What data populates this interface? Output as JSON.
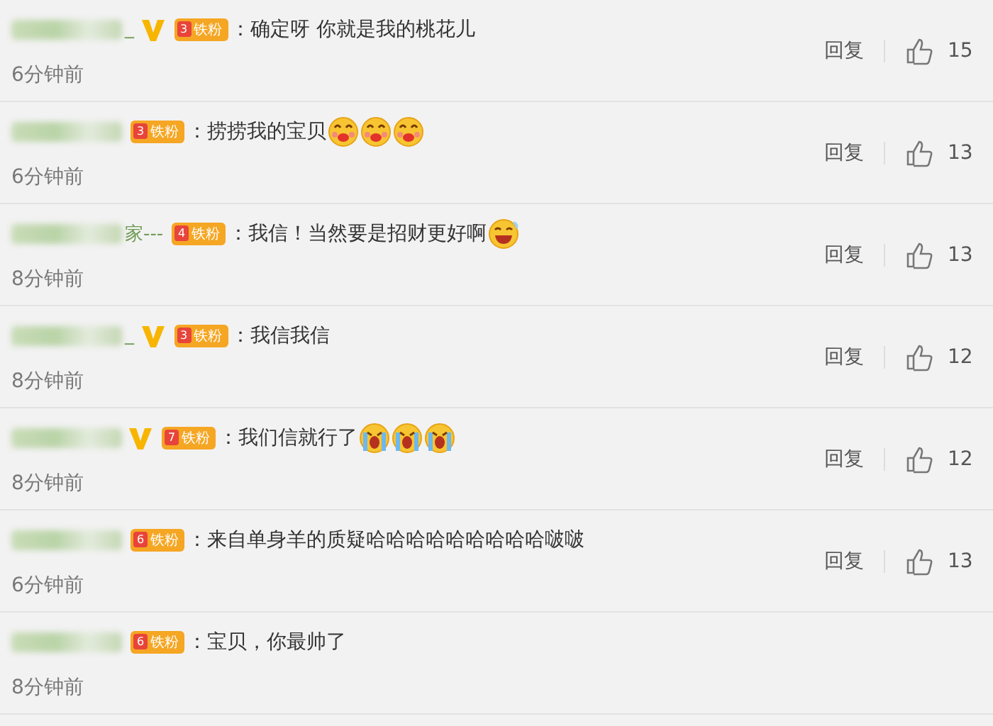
{
  "comments": [
    {
      "name_suffix": "_",
      "verified": true,
      "badge": {
        "level": "3",
        "label": "铁粉"
      },
      "text": "：确定呀 你就是我的桃花儿",
      "time": "6分钟前",
      "reply": "回复",
      "likes": "15"
    },
    {
      "verified": false,
      "badge": {
        "level": "3",
        "label": "铁粉"
      },
      "text": "：捞捞我的宝贝",
      "emojis": [
        {
          "kind": "kiss"
        },
        {
          "kind": "kiss"
        },
        {
          "kind": "kiss"
        }
      ],
      "time": "6分钟前",
      "reply": "回复",
      "likes": "13"
    },
    {
      "name_suffix": "家---",
      "verified": false,
      "badge": {
        "level": "4",
        "label": "铁粉"
      },
      "text": "：我信！当然要是招财更好啊",
      "emojis": [
        {
          "kind": "laugh"
        }
      ],
      "time": "8分钟前",
      "reply": "回复",
      "likes": "13"
    },
    {
      "name_suffix": "_",
      "verified": true,
      "badge": {
        "level": "3",
        "label": "铁粉"
      },
      "text": "：我信我信",
      "time": "8分钟前",
      "reply": "回复",
      "likes": "12"
    },
    {
      "verified": true,
      "badge": {
        "level": "7",
        "label": "铁粉"
      },
      "text": "：我们信就行了",
      "emojis": [
        {
          "kind": "cry"
        },
        {
          "kind": "cry"
        },
        {
          "kind": "cry"
        }
      ],
      "time": "8分钟前",
      "reply": "回复",
      "likes": "12"
    },
    {
      "verified": false,
      "badge": {
        "level": "6",
        "label": "铁粉"
      },
      "text": "：来自单身羊的质疑哈哈哈哈哈哈哈哈哈啵啵",
      "time": "6分钟前",
      "reply": "回复",
      "likes": "13"
    },
    {
      "verified": false,
      "badge": {
        "level": "6",
        "label": "铁粉"
      },
      "text": "：宝贝，你最帅了",
      "time": "8分钟前"
    }
  ]
}
